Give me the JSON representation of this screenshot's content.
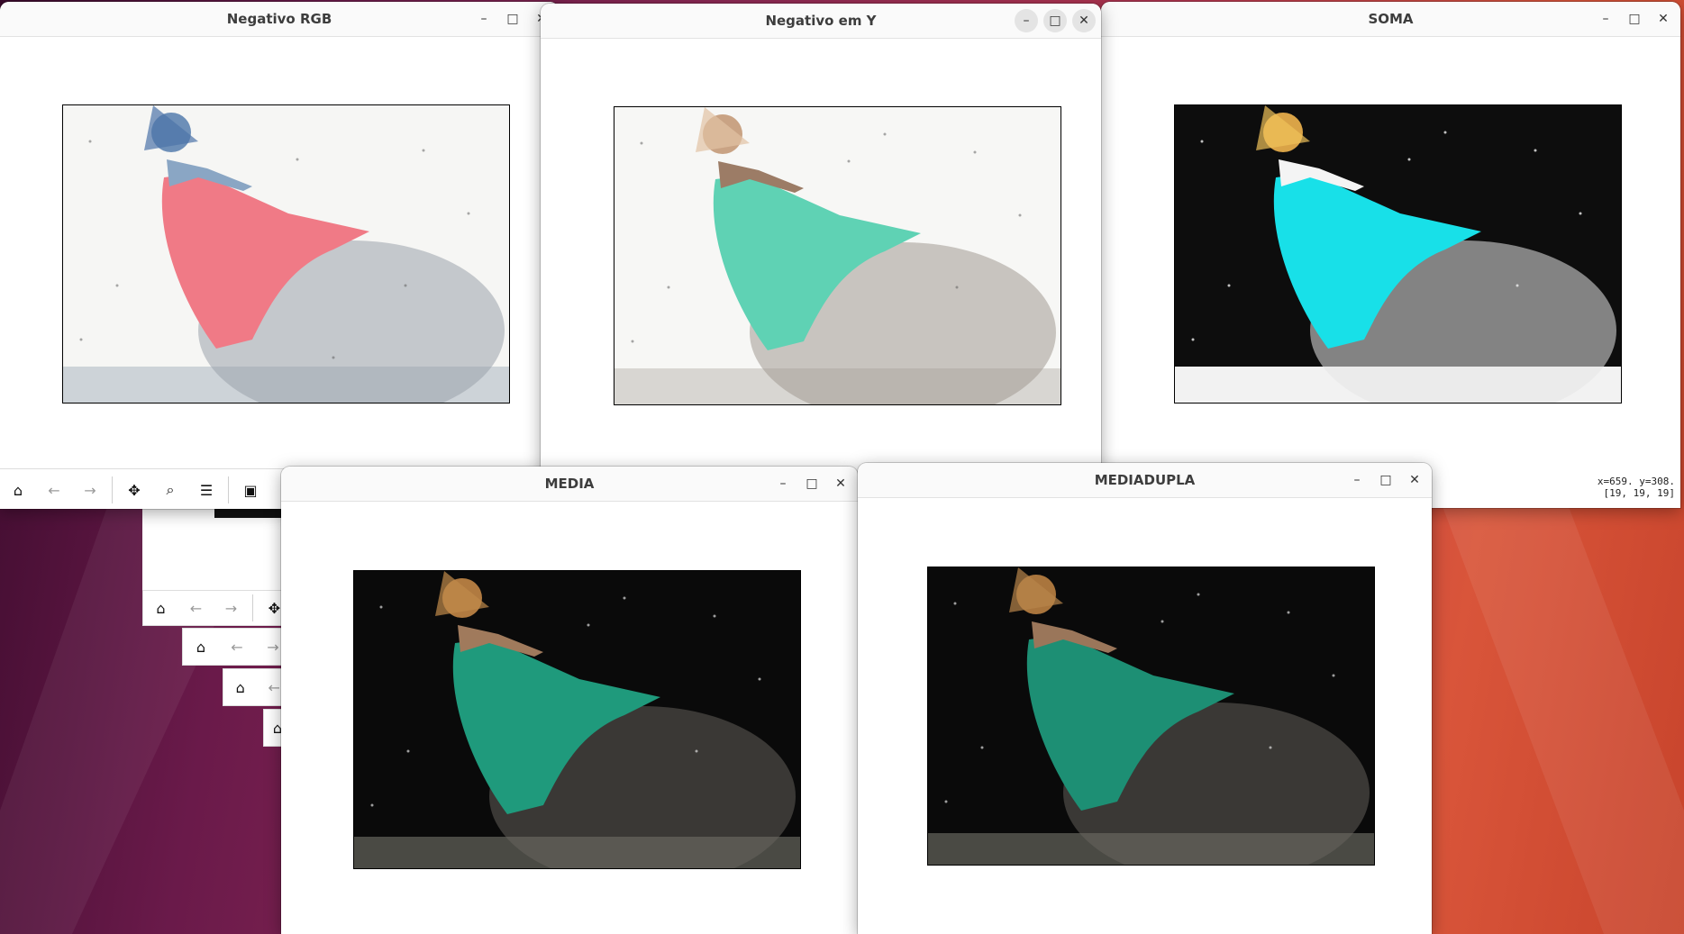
{
  "windows": {
    "neg_rgb": {
      "title": "Negativo RGB"
    },
    "neg_y": {
      "title": "Negativo em Y"
    },
    "soma": {
      "title": "SOMA"
    },
    "media": {
      "title": "MEDIA"
    },
    "mediadupla": {
      "title": "MEDIADUPLA"
    }
  },
  "controls": {
    "minimize": "–",
    "maximize": "□",
    "close": "✕"
  },
  "toolbar": {
    "home": "⌂",
    "back": "←",
    "forward": "→",
    "pan": "✥",
    "zoom": "⌕",
    "configure": "☰",
    "save": "▣"
  },
  "status": {
    "coords_line1": "x=659. y=308.",
    "coords_line2": "[19, 19, 19]"
  },
  "icons": {
    "home": "home-icon",
    "back": "arrow-left-icon",
    "forward": "arrow-right-icon",
    "pan": "move-icon",
    "zoom": "magnifier-icon",
    "configure": "sliders-icon",
    "save": "floppy-icon"
  },
  "colors": {
    "desktop_start": "#3a0b2c",
    "desktop_end": "#d9553a",
    "dress_neg_rgb": "#f07a86",
    "dress_neg_y": "#5fd2b4",
    "dress_soma": "#18e0e8",
    "dress_media": "#1f9a7c"
  }
}
